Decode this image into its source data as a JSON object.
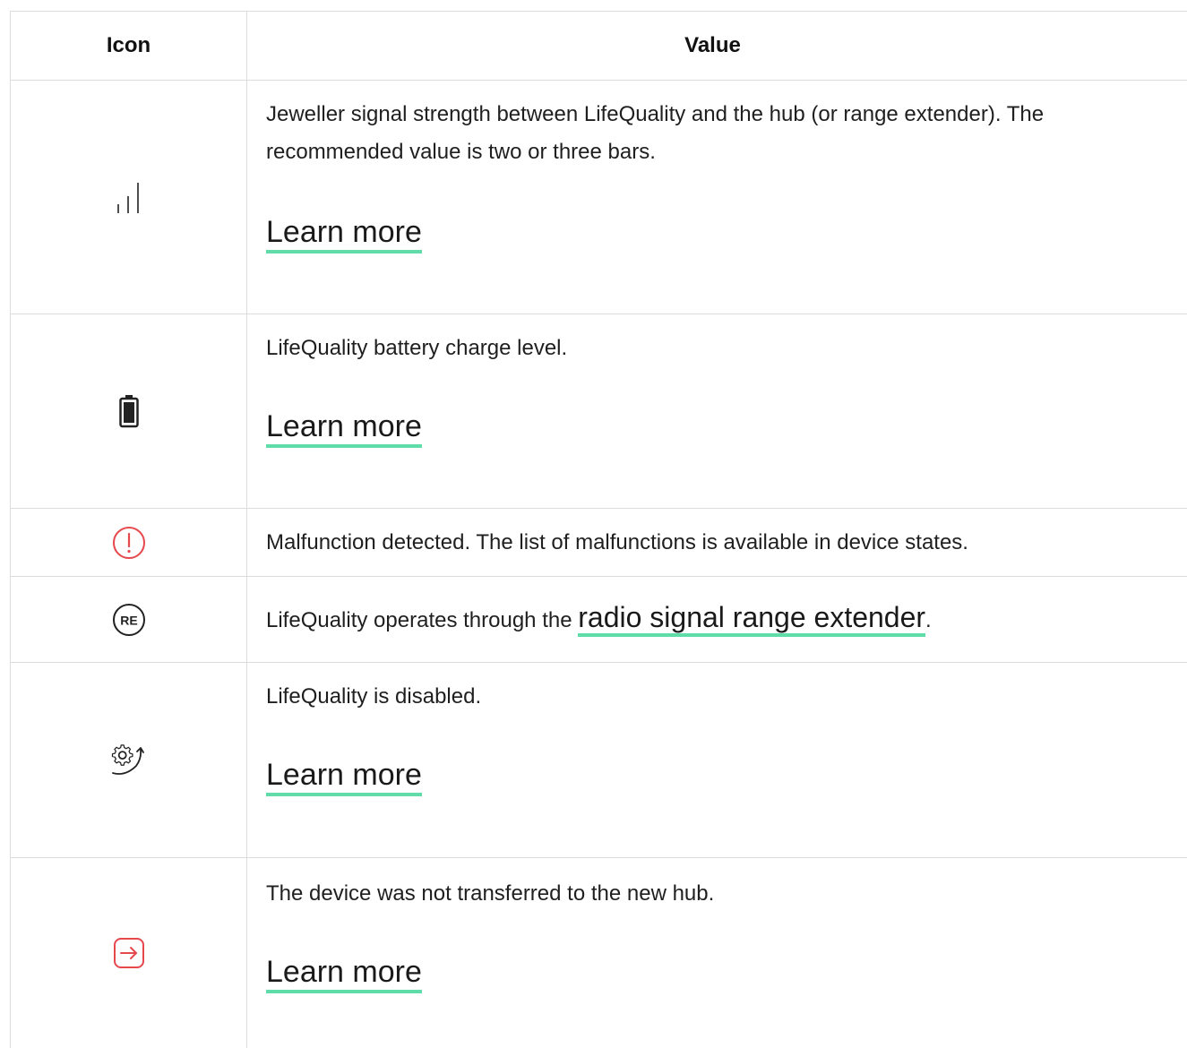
{
  "header": {
    "icon_col": "Icon",
    "value_col": "Value"
  },
  "rows": [
    {
      "icon": "signal-bars-icon",
      "text": "Jeweller signal strength between LifeQuality and the hub (or range extender). The recommended value is two or three bars.",
      "link": "Learn more"
    },
    {
      "icon": "battery-icon",
      "text": "LifeQuality battery charge level.",
      "link": "Learn more"
    },
    {
      "icon": "malfunction-icon",
      "text": "Malfunction detected. The list of malfunctions is available in device states."
    },
    {
      "icon": "range-extender-icon",
      "icon_text": "RE",
      "text_before": "LifeQuality operates through the ",
      "link": "radio signal range extender",
      "text_after": "."
    },
    {
      "icon": "disabled-gear-icon",
      "text": "LifeQuality is disabled.",
      "link": "Learn more"
    },
    {
      "icon": "not-transferred-icon",
      "text": "The device was not transferred to the new hub.",
      "link": "Learn more"
    }
  ],
  "colors": {
    "accent_underline": "#5fdca8",
    "alert_red": "#e5484d",
    "border": "#dcdcdc"
  }
}
